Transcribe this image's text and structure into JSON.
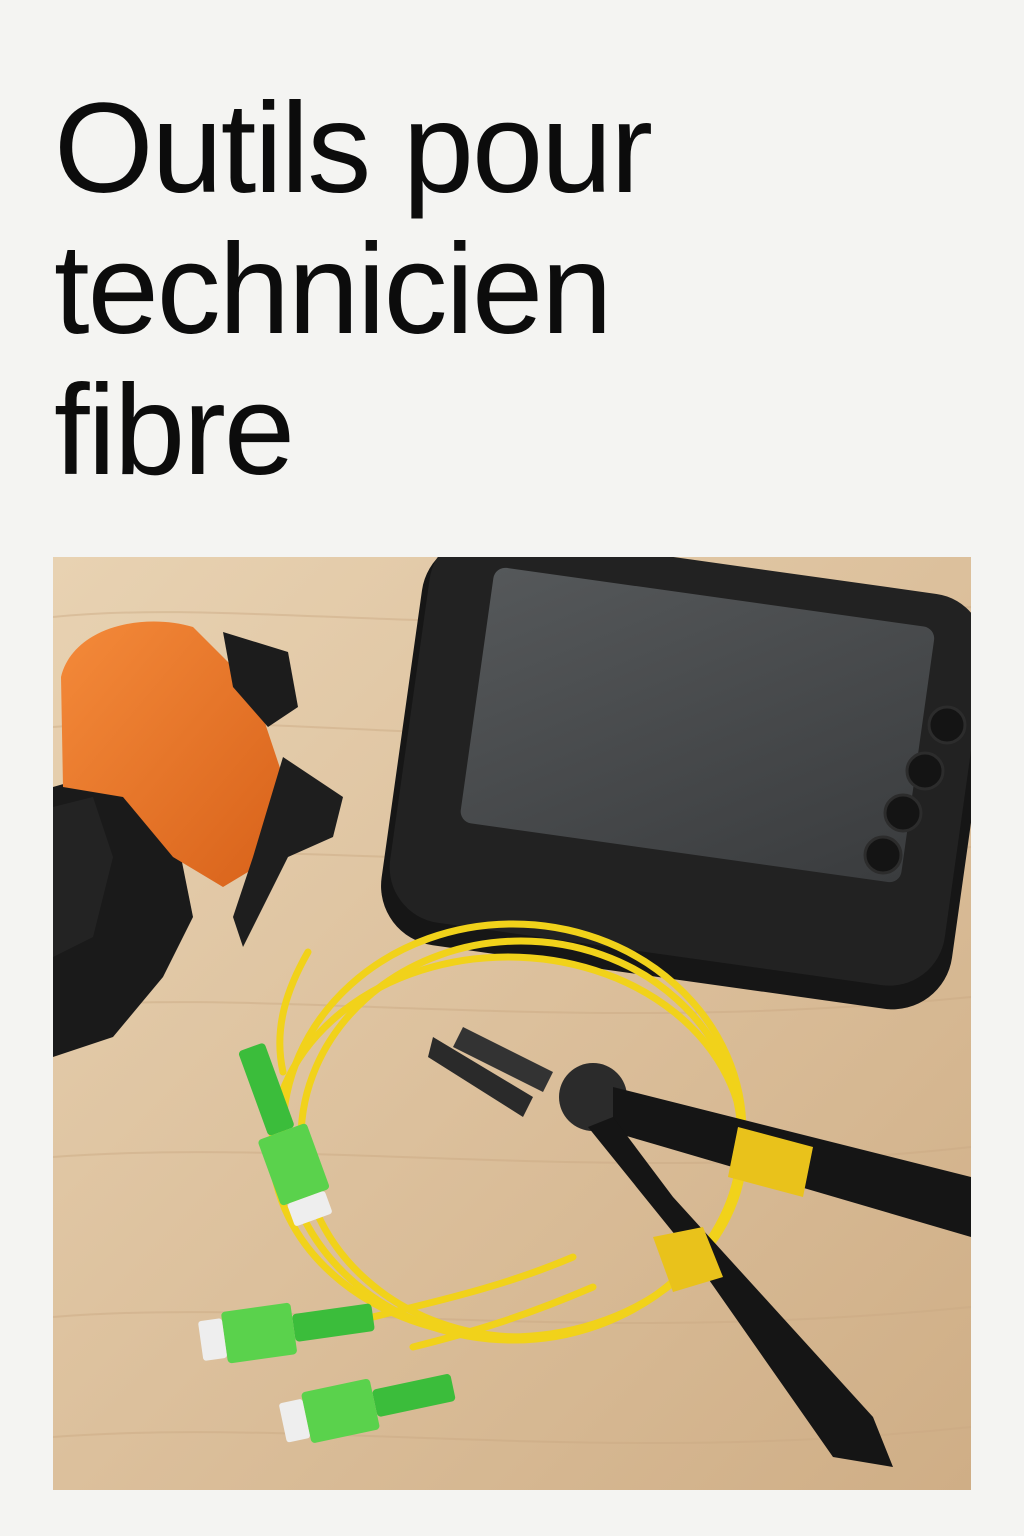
{
  "title": {
    "lines": [
      "Outils pour",
      "technicien",
      "fibre"
    ]
  },
  "photo": {
    "subject_icons": [
      "fiber-cleaver-icon",
      "otdr-screen-device-icon",
      "fiber-patch-cable-icon",
      "sc-apc-connector-icon",
      "pliers-icon"
    ]
  }
}
